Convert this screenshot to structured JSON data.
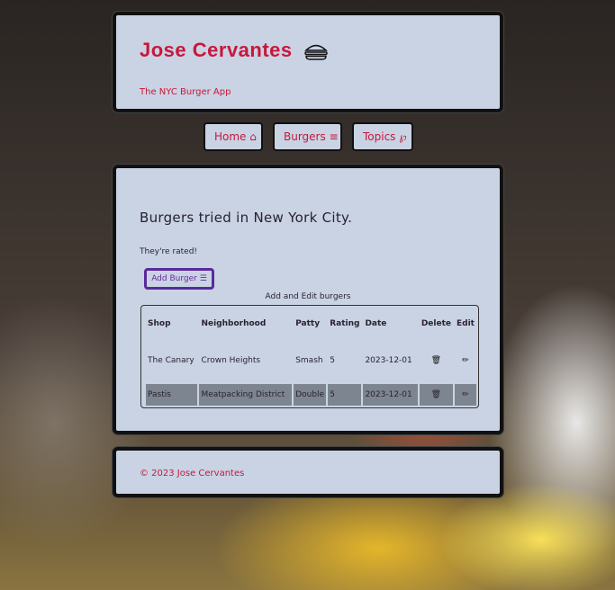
{
  "header": {
    "title": "Jose Cervantes",
    "subtitle": "The NYC Burger App"
  },
  "nav": {
    "home_label": "Home",
    "burgers_label": "Burgers",
    "topics_label": "Topics"
  },
  "main": {
    "title": "Burgers tried in New York City.",
    "description": "They're rated!",
    "add_button_label": "Add Burger",
    "table_caption": "Add and Edit burgers",
    "columns": [
      "Shop",
      "Neighborhood",
      "Patty",
      "Rating",
      "Date",
      "Delete",
      "Edit"
    ],
    "rows": [
      {
        "shop": "The Canary",
        "neighborhood": "Crown Heights",
        "patty": "Smash",
        "rating": "5",
        "date": "2023-12-01"
      },
      {
        "shop": "Pastis",
        "neighborhood": "Meatpacking District",
        "patty": "Double",
        "rating": "5",
        "date": "2023-12-01"
      }
    ]
  },
  "footer": {
    "copyright": "© 2023 Jose Cervantes"
  },
  "colors": {
    "accent": "#c8173a",
    "panel": "#c9d3e4",
    "button_border": "#5a2a9a",
    "row_highlight": "#7d8591"
  },
  "icons": {
    "home": "home-icon",
    "burgers": "menu-icon",
    "topics": "topics-icon",
    "title": "burger-icon",
    "delete": "trash-icon",
    "edit": "pencil-icon"
  }
}
